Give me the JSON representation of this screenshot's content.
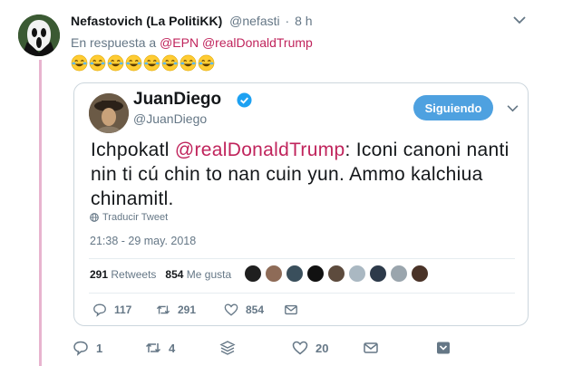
{
  "tweet": {
    "author_name": "Nefastovich (La PolitiKK)",
    "author_handle": "@nefasti",
    "separator": "·",
    "time": "8 h",
    "reply_prefix": "En respuesta a",
    "reply_mentions": [
      "@EPN",
      "@realDonaldTrump"
    ],
    "emoji_count_icon": "face-with-tears-of-joy-icon",
    "actions": {
      "reply_count": "1",
      "retweet_count": "4",
      "like_count": "20"
    }
  },
  "quoted": {
    "name": "JuanDiego",
    "handle": "@JuanDiego",
    "follow_label": "Siguiendo",
    "text_before": "Ichpokatl ",
    "text_mention": "@realDonaldTrump",
    "text_after": ": Iconi canoni nanti nin ti cú chin to nan cuin yun. Ammo kalchiua chinamitl.",
    "translate_label": "Traducir Tweet",
    "timestamp": "21:38 - 29 may. 2018",
    "retweets_count": "291",
    "retweets_label": "Retweets",
    "likes_count": "854",
    "likes_label": "Me gusta",
    "actions": {
      "reply_count": "117",
      "retweet_count": "291",
      "like_count": "854"
    }
  },
  "colors": {
    "accent": "#4ea1e0",
    "mention": "#c0245c",
    "thread": "#e8b4cf",
    "muted": "#657786"
  }
}
